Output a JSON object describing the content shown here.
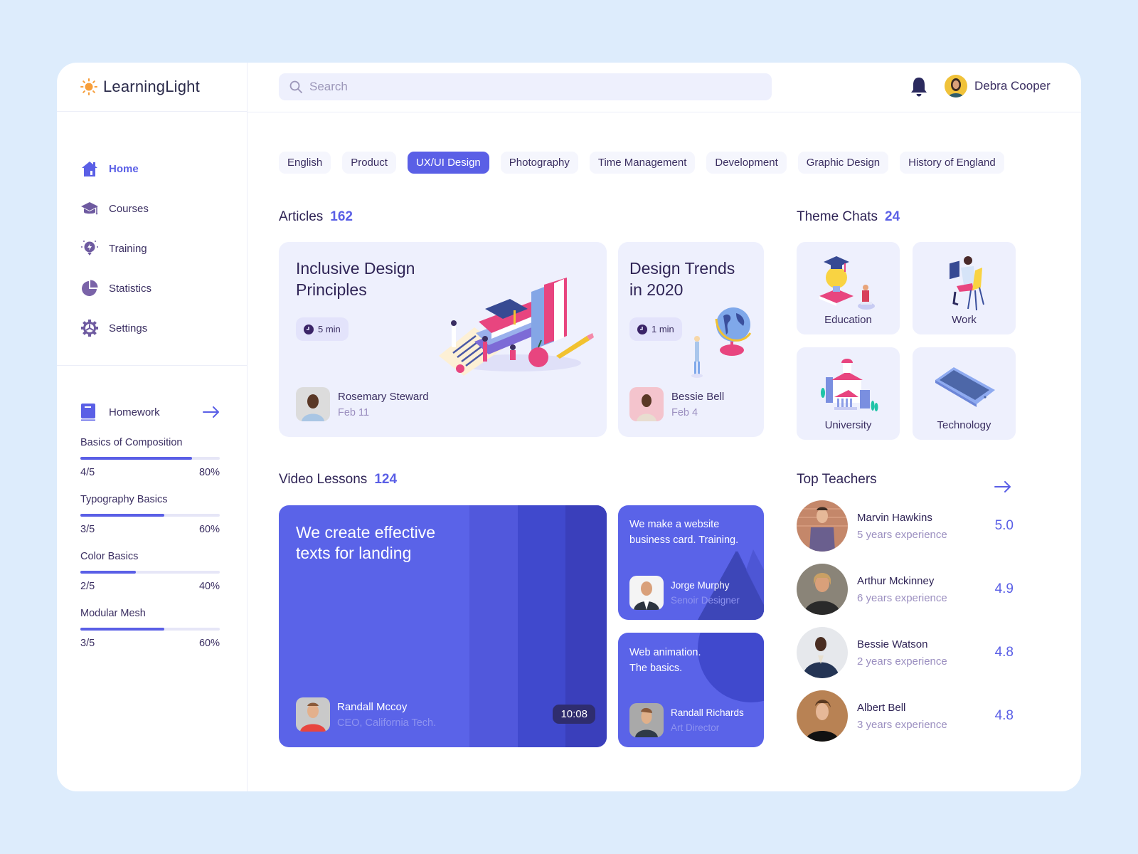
{
  "app": {
    "name": "LearningLight",
    "brand_color": "#5a5fe6",
    "accent_color": "#f79e3a"
  },
  "header": {
    "search": {
      "placeholder": "Search",
      "value": ""
    },
    "user": {
      "name": "Debra Cooper"
    }
  },
  "sidebar": {
    "items": [
      {
        "label": "Home",
        "icon": "home-icon",
        "active": true
      },
      {
        "label": "Courses",
        "icon": "graduation-cap-icon",
        "active": false
      },
      {
        "label": "Training",
        "icon": "lightbulb-icon",
        "active": false
      },
      {
        "label": "Statistics",
        "icon": "pie-chart-icon",
        "active": false
      },
      {
        "label": "Settings",
        "icon": "gear-icon",
        "active": false
      }
    ],
    "homework": {
      "label": "Homework",
      "items": [
        {
          "title": "Basics of Composition",
          "done": "4/5",
          "percent_label": "80%",
          "progress": 0.8
        },
        {
          "title": "Typography Basics",
          "done": "3/5",
          "percent_label": "60%",
          "progress": 0.6
        },
        {
          "title": "Color Basics",
          "done": "2/5",
          "percent_label": "40%",
          "progress": 0.4
        },
        {
          "title": "Modular Mesh",
          "done": "3/5",
          "percent_label": "60%",
          "progress": 0.6
        }
      ]
    }
  },
  "categories": {
    "items": [
      "English",
      "Product",
      "UX/UI Design",
      "Photography",
      "Time Management",
      "Development",
      "Graphic Design",
      "History of England"
    ],
    "active": "UX/UI Design"
  },
  "articles": {
    "title": "Articles",
    "count": "162",
    "cards": [
      {
        "title_line1": "Inclusive Design",
        "title_line2": "Principles",
        "read_time": "5 min",
        "author": "Rosemary Steward",
        "date": "Feb 11"
      },
      {
        "title_line1": "Design Trends",
        "title_line2": "in 2020",
        "read_time": "1 min",
        "author": "Bessie Bell",
        "date": "Feb 4"
      }
    ]
  },
  "theme_chats": {
    "title": "Theme Chats",
    "count": "24",
    "items": [
      {
        "label": "Education"
      },
      {
        "label": "Work"
      },
      {
        "label": "University"
      },
      {
        "label": "Technology"
      }
    ]
  },
  "video_lessons": {
    "title": "Video Lessons",
    "count": "124",
    "main": {
      "title_line1": "We create effective",
      "title_line2": "texts for landing",
      "author": "Randall Mccoy",
      "role": "CEO, California Tech.",
      "duration": "10:08"
    },
    "side": [
      {
        "title_line1": "We make a website",
        "title_line2": "business card. Training.",
        "author": "Jorge Murphy",
        "role": "Senoir Designer"
      },
      {
        "title_line1": "Web animation.",
        "title_line2": "The basics.",
        "author": "Randall Richards",
        "role": "Art Director"
      }
    ]
  },
  "top_teachers": {
    "title": "Top Teachers",
    "items": [
      {
        "name": "Marvin Hawkins",
        "experience": "5 years experience",
        "rating": "5.0"
      },
      {
        "name": "Arthur Mckinney",
        "experience": "6 years experience",
        "rating": "4.9"
      },
      {
        "name": "Bessie Watson",
        "experience": "2 years experience",
        "rating": "4.8"
      },
      {
        "name": "Albert Bell",
        "experience": "3 years experience",
        "rating": "4.8"
      }
    ]
  }
}
